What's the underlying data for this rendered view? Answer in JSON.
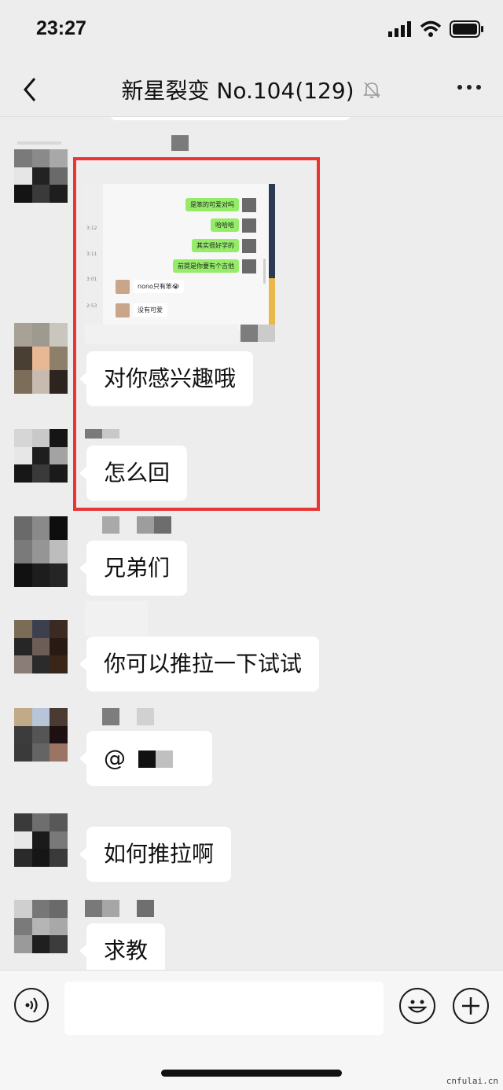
{
  "status": {
    "time": "23:27"
  },
  "header": {
    "title": "新星裂变 No.104(129)"
  },
  "screenshot_msgs": {
    "right": [
      "是笨的可爱对吗",
      "哈哈哈",
      "其实很好学的",
      "前提是你要有个吉他"
    ],
    "left": [
      "nono只有笨😭",
      "没有可爱"
    ],
    "times": [
      "3:12",
      "3:11",
      "3:01",
      "2:53"
    ]
  },
  "messages": [
    {
      "text": "对你感兴趣哦"
    },
    {
      "text": "怎么回"
    },
    {
      "text": "兄弟们"
    },
    {
      "text": "你可以推拉一下试试"
    },
    {
      "text": "@"
    },
    {
      "text": "如何推拉啊"
    },
    {
      "text": "求教"
    }
  ],
  "watermark": "cnfulai.cn",
  "colors": {
    "accent_box": "#e93534",
    "bubble_green": "#95ec69"
  }
}
